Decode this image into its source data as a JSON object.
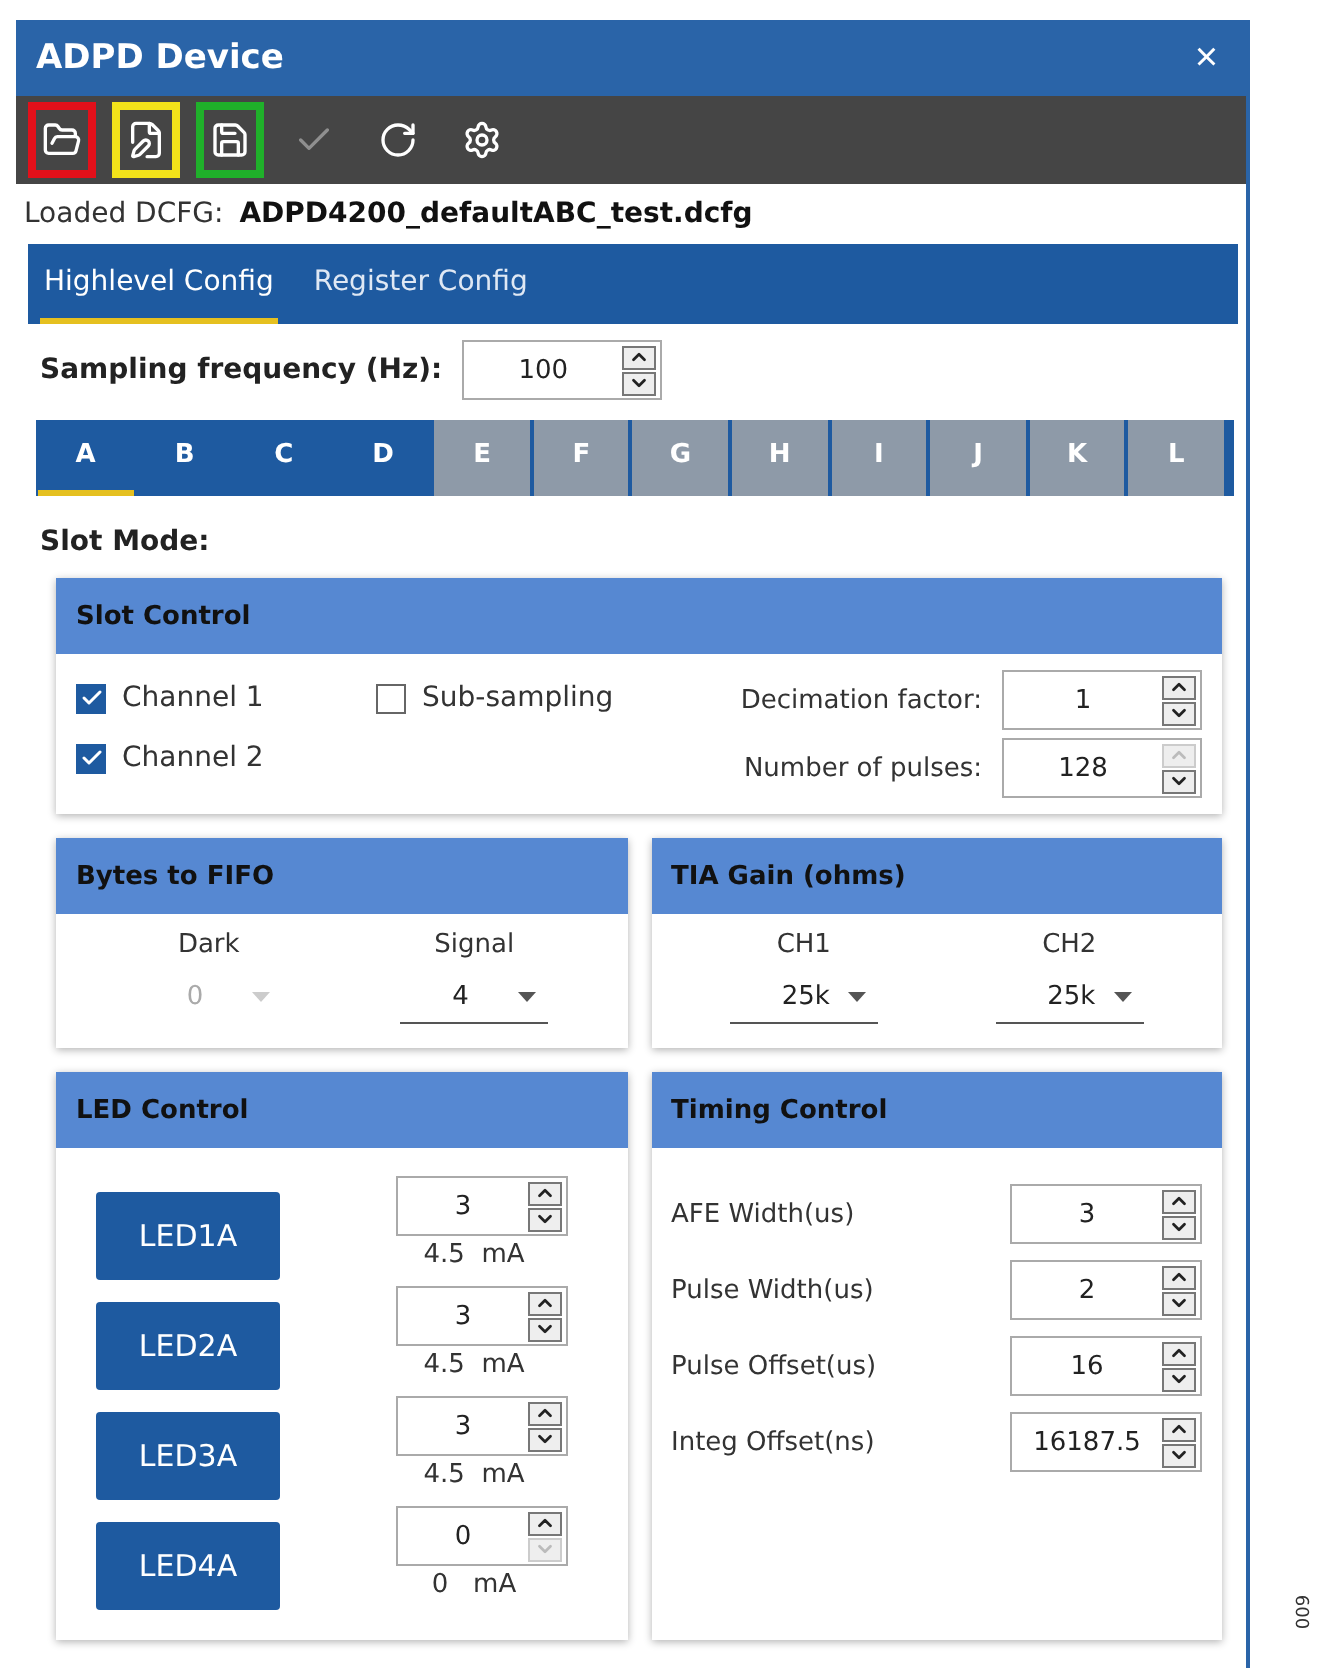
{
  "window": {
    "title": "ADPD Device",
    "close": "×"
  },
  "toolbar": [
    {
      "kind": "open",
      "disabled": false,
      "color": "#e3101a"
    },
    {
      "kind": "edit",
      "disabled": false,
      "color": "#f2e31a"
    },
    {
      "kind": "save",
      "disabled": false,
      "color": "#1fb02a"
    },
    {
      "kind": "check",
      "disabled": true
    },
    {
      "kind": "refresh",
      "disabled": false
    },
    {
      "kind": "settings",
      "disabled": false
    }
  ],
  "loaded": {
    "label": "Loaded DCFG:",
    "file": "ADPD4200_defaultABC_test.dcfg"
  },
  "tabs": [
    {
      "label": "Highlevel Config",
      "selected": true
    },
    {
      "label": "Register Config",
      "selected": false
    }
  ],
  "sampling": {
    "label": "Sampling frequency (Hz):",
    "value": "100"
  },
  "slots": [
    {
      "label": "A",
      "selected": true,
      "disabled": false
    },
    {
      "label": "B",
      "selected": false,
      "disabled": false
    },
    {
      "label": "C",
      "selected": false,
      "disabled": false
    },
    {
      "label": "D",
      "selected": false,
      "disabled": false
    },
    {
      "label": "E",
      "selected": false,
      "disabled": true
    },
    {
      "label": "F",
      "selected": false,
      "disabled": true
    },
    {
      "label": "G",
      "selected": false,
      "disabled": true
    },
    {
      "label": "H",
      "selected": false,
      "disabled": true
    },
    {
      "label": "I",
      "selected": false,
      "disabled": true
    },
    {
      "label": "J",
      "selected": false,
      "disabled": true
    },
    {
      "label": "K",
      "selected": false,
      "disabled": true
    },
    {
      "label": "L",
      "selected": false,
      "disabled": true
    }
  ],
  "slot_mode": "Slot Mode:",
  "slot_control": {
    "title": "Slot Control",
    "checkboxes": [
      {
        "label": "Channel 1",
        "checked": true
      },
      {
        "label": "Sub-sampling",
        "checked": false
      },
      {
        "label": "Channel 2",
        "checked": true
      }
    ],
    "steppers": [
      {
        "label": "Decimation factor:",
        "value": "1",
        "up_disabled": false,
        "down_disabled": false
      },
      {
        "label": "Number of pulses:",
        "value": "128",
        "up_disabled": true,
        "down_disabled": false
      }
    ]
  },
  "bytes_to_fifo": {
    "title": "Bytes to FIFO",
    "selects": [
      {
        "label": "Dark",
        "value": "0",
        "disabled": true
      },
      {
        "label": "Signal",
        "value": "4",
        "disabled": false
      }
    ]
  },
  "tia_gain": {
    "title": "TIA Gain (ohms)",
    "selects": [
      {
        "label": "CH1",
        "value": "25k",
        "disabled": false
      },
      {
        "label": "CH2",
        "value": "25k",
        "disabled": false
      }
    ]
  },
  "led_control": {
    "title": "LED Control",
    "leds": [
      {
        "label": "LED1A",
        "value": "3",
        "current": "4.5  mA",
        "down_disabled": false
      },
      {
        "label": "LED2A",
        "value": "3",
        "current": "4.5  mA",
        "down_disabled": false
      },
      {
        "label": "LED3A",
        "value": "3",
        "current": "4.5  mA",
        "down_disabled": false
      },
      {
        "label": "LED4A",
        "value": "0",
        "current": "0   mA",
        "down_disabled": true
      }
    ]
  },
  "timing_control": {
    "title": "Timing Control",
    "rows": [
      {
        "label": "AFE Width(us)",
        "value": "3"
      },
      {
        "label": "Pulse Width(us)",
        "value": "2"
      },
      {
        "label": "Pulse Offset(us)",
        "value": "16"
      },
      {
        "label": "Integ Offset(ns)",
        "value": "16187.5"
      }
    ]
  },
  "figure_id": "009"
}
